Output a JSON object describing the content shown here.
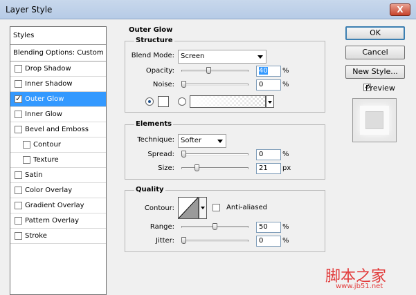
{
  "window": {
    "title": "Layer Style",
    "close_label": "X"
  },
  "styles_panel": {
    "header": "Styles",
    "blending": "Blending Options: Custom",
    "items": [
      {
        "label": "Drop Shadow",
        "checked": false,
        "indent": false,
        "selected": false
      },
      {
        "label": "Inner Shadow",
        "checked": false,
        "indent": false,
        "selected": false
      },
      {
        "label": "Outer Glow",
        "checked": true,
        "indent": false,
        "selected": true
      },
      {
        "label": "Inner Glow",
        "checked": false,
        "indent": false,
        "selected": false
      },
      {
        "label": "Bevel and Emboss",
        "checked": false,
        "indent": false,
        "selected": false
      },
      {
        "label": "Contour",
        "checked": false,
        "indent": true,
        "selected": false
      },
      {
        "label": "Texture",
        "checked": false,
        "indent": true,
        "selected": false
      },
      {
        "label": "Satin",
        "checked": false,
        "indent": false,
        "selected": false
      },
      {
        "label": "Color Overlay",
        "checked": false,
        "indent": false,
        "selected": false
      },
      {
        "label": "Gradient Overlay",
        "checked": false,
        "indent": false,
        "selected": false
      },
      {
        "label": "Pattern Overlay",
        "checked": false,
        "indent": false,
        "selected": false
      },
      {
        "label": "Stroke",
        "checked": false,
        "indent": false,
        "selected": false
      }
    ]
  },
  "panel": {
    "title": "Outer Glow",
    "structure": {
      "title": "Structure",
      "blend_mode_label": "Blend Mode:",
      "blend_mode_value": "Screen",
      "opacity_label": "Opacity:",
      "opacity_value": "40",
      "opacity_level": 40,
      "opacity_unit": "%",
      "noise_label": "Noise:",
      "noise_value": "0",
      "noise_level": 0,
      "noise_unit": "%"
    },
    "elements": {
      "title": "Elements",
      "technique_label": "Technique:",
      "technique_value": "Softer",
      "spread_label": "Spread:",
      "spread_value": "0",
      "spread_level": 0,
      "spread_unit": "%",
      "size_label": "Size:",
      "size_value": "21",
      "size_level": 21,
      "size_unit": "px"
    },
    "quality": {
      "title": "Quality",
      "contour_label": "Contour:",
      "anti_aliased_label": "Anti-aliased",
      "range_label": "Range:",
      "range_value": "50",
      "range_level": 50,
      "range_unit": "%",
      "jitter_label": "Jitter:",
      "jitter_value": "0",
      "jitter_level": 0,
      "jitter_unit": "%"
    }
  },
  "buttons": {
    "ok": "OK",
    "cancel": "Cancel",
    "new_style": "New Style...",
    "preview_label": "Preview",
    "preview_checked": true
  },
  "watermark": {
    "line1": "脚本之家",
    "line2": "www.jb51.net"
  }
}
